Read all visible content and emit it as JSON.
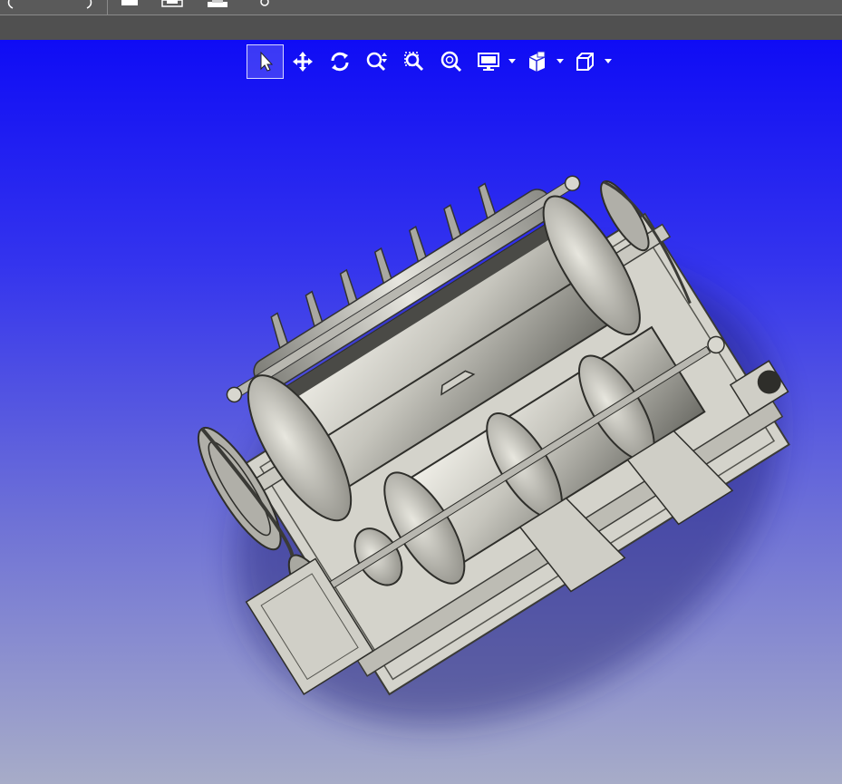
{
  "app": {
    "colors": {
      "window_chrome": "#5a5a5a",
      "sub_chrome": "#505050",
      "viewport_top": "#0f0cf5",
      "viewport_bottom": "#a7acc8",
      "model_steel": "#c9c8c0",
      "toolbar_icon": "#ffffff"
    }
  },
  "top_toolbar": {
    "icons": [
      "undo-icon",
      "redo-icon",
      "new-document-icon",
      "save-icon",
      "print-icon",
      "settings-icon"
    ]
  },
  "view_toolbar": {
    "tools": [
      {
        "icon": "select-cursor-icon",
        "active": true
      },
      {
        "icon": "pan-move-icon",
        "active": false
      },
      {
        "icon": "rotate-view-icon",
        "active": false
      },
      {
        "icon": "zoom-in-out-icon",
        "active": false
      },
      {
        "icon": "zoom-window-icon",
        "active": false
      },
      {
        "icon": "zoom-to-fit-icon",
        "active": false
      },
      {
        "icon": "display-style-icon",
        "active": false,
        "dropdown": true
      },
      {
        "icon": "section-view-icon",
        "active": false,
        "dropdown": true
      },
      {
        "icon": "view-orientation-cube-icon",
        "active": false,
        "dropdown": true
      }
    ]
  }
}
